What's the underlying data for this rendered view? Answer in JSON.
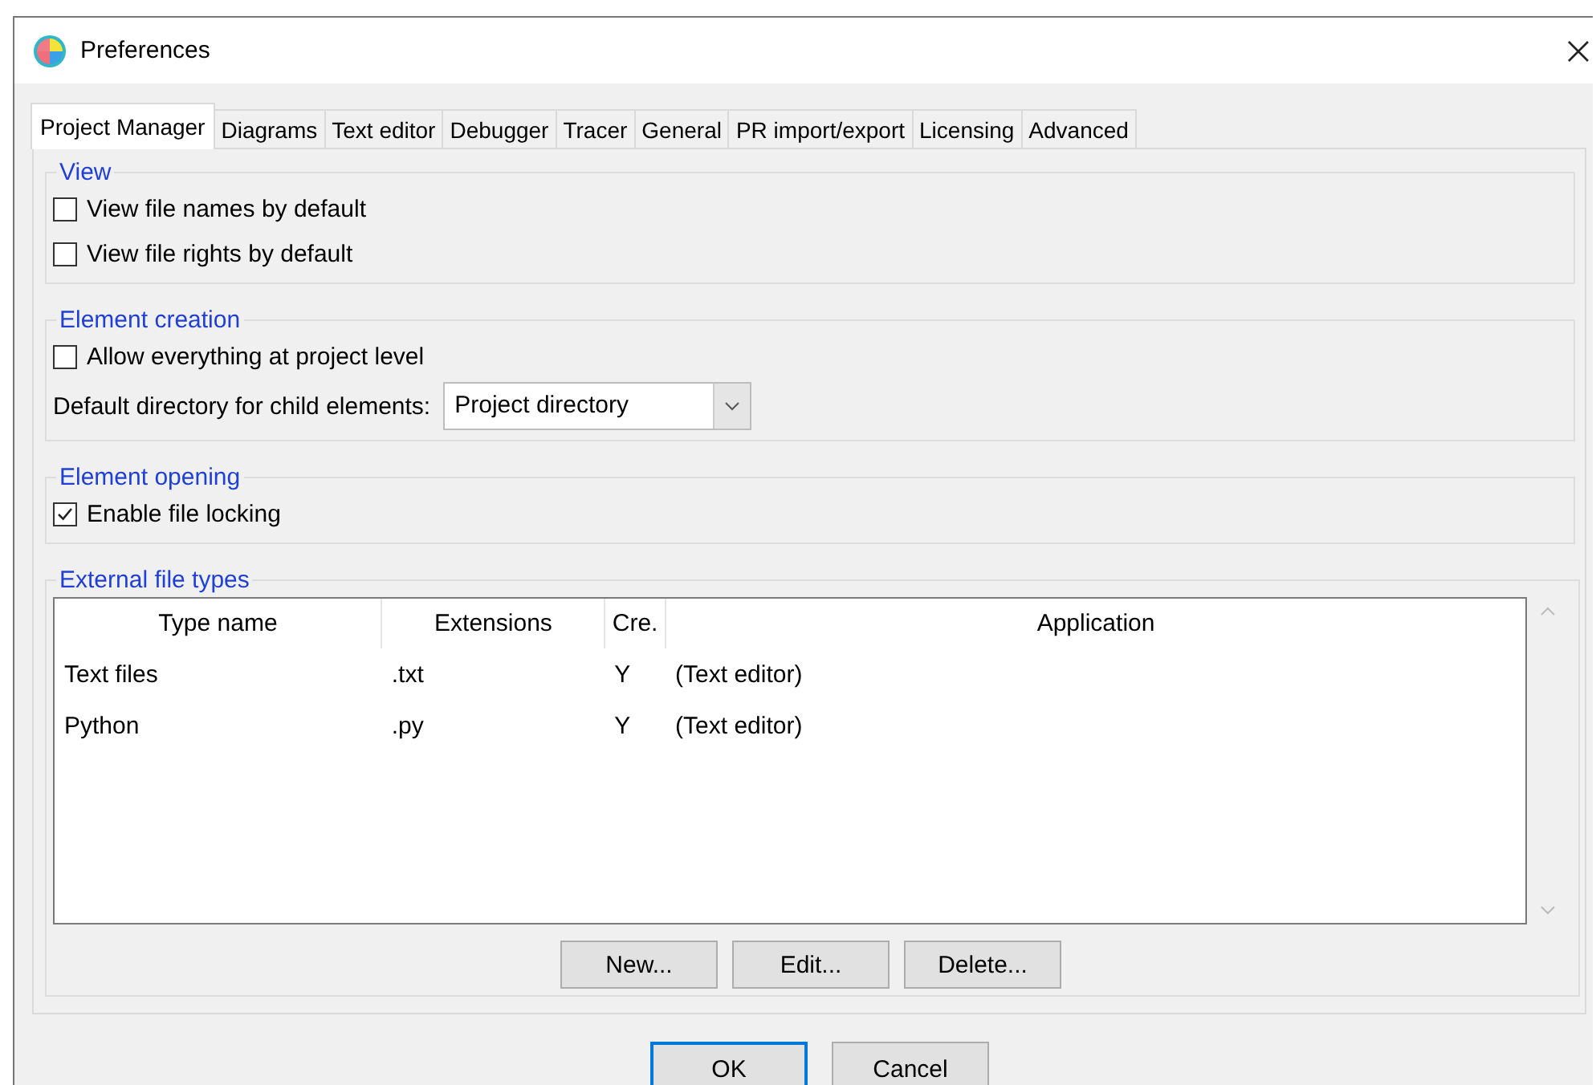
{
  "window": {
    "title": "Preferences"
  },
  "tabs": [
    {
      "label": "Project Manager",
      "selected": true
    },
    {
      "label": "Diagrams",
      "selected": false
    },
    {
      "label": "Text editor",
      "selected": false
    },
    {
      "label": "Debugger",
      "selected": false
    },
    {
      "label": "Tracer",
      "selected": false
    },
    {
      "label": "General",
      "selected": false
    },
    {
      "label": "PR import/export",
      "selected": false
    },
    {
      "label": "Licensing",
      "selected": false
    },
    {
      "label": "Advanced",
      "selected": false
    }
  ],
  "groups": [
    {
      "kind": "options",
      "title": "View",
      "checkboxes": [
        {
          "label": "View file names by default",
          "checked": false
        },
        {
          "label": "View file rights by default",
          "checked": false
        }
      ]
    },
    {
      "kind": "options",
      "title": "Element creation",
      "checkboxes": [
        {
          "label": "Allow everything at project level",
          "checked": false
        }
      ],
      "dropdown": {
        "label": "Default directory for child elements:",
        "value": "Project directory"
      }
    },
    {
      "kind": "options",
      "title": "Element opening",
      "checkboxes": [
        {
          "label": "Enable file locking",
          "checked": true
        }
      ]
    },
    {
      "kind": "table",
      "title": "External file types",
      "table": {
        "columns": [
          "Type name",
          "Extensions",
          "Cre.",
          "Application"
        ],
        "rows": [
          [
            "Text files",
            ".txt",
            "Y",
            "(Text editor)"
          ],
          [
            "Python",
            ".py",
            "Y",
            "(Text editor)"
          ]
        ]
      },
      "buttons": [
        "New...",
        "Edit...",
        "Delete..."
      ]
    }
  ],
  "buttons": [
    {
      "label": "OK",
      "default": true
    },
    {
      "label": "Cancel",
      "default": false
    }
  ]
}
